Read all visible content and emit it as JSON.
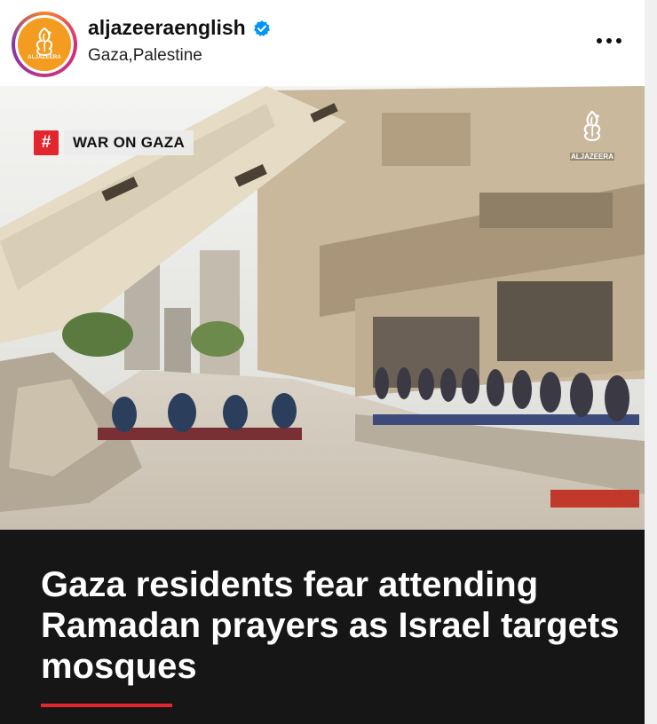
{
  "post": {
    "username": "aljazeeraenglish",
    "location": "Gaza,Palestine",
    "avatar_text": "ALJAZEERA"
  },
  "image": {
    "tag_symbol": "#",
    "tag_label": "WAR ON GAZA",
    "logo_text": "ALJAZEERA"
  },
  "headline": "Gaza residents fear attending Ramadan prayers as Israel targets mosques",
  "icons": {
    "verified": "verified-badge-icon",
    "more": "more-options-icon"
  },
  "colors": {
    "brand_orange": "#f39c1f",
    "accent_red": "#e3262d",
    "caption_bg": "#161616",
    "verified_blue": "#0095f6"
  }
}
